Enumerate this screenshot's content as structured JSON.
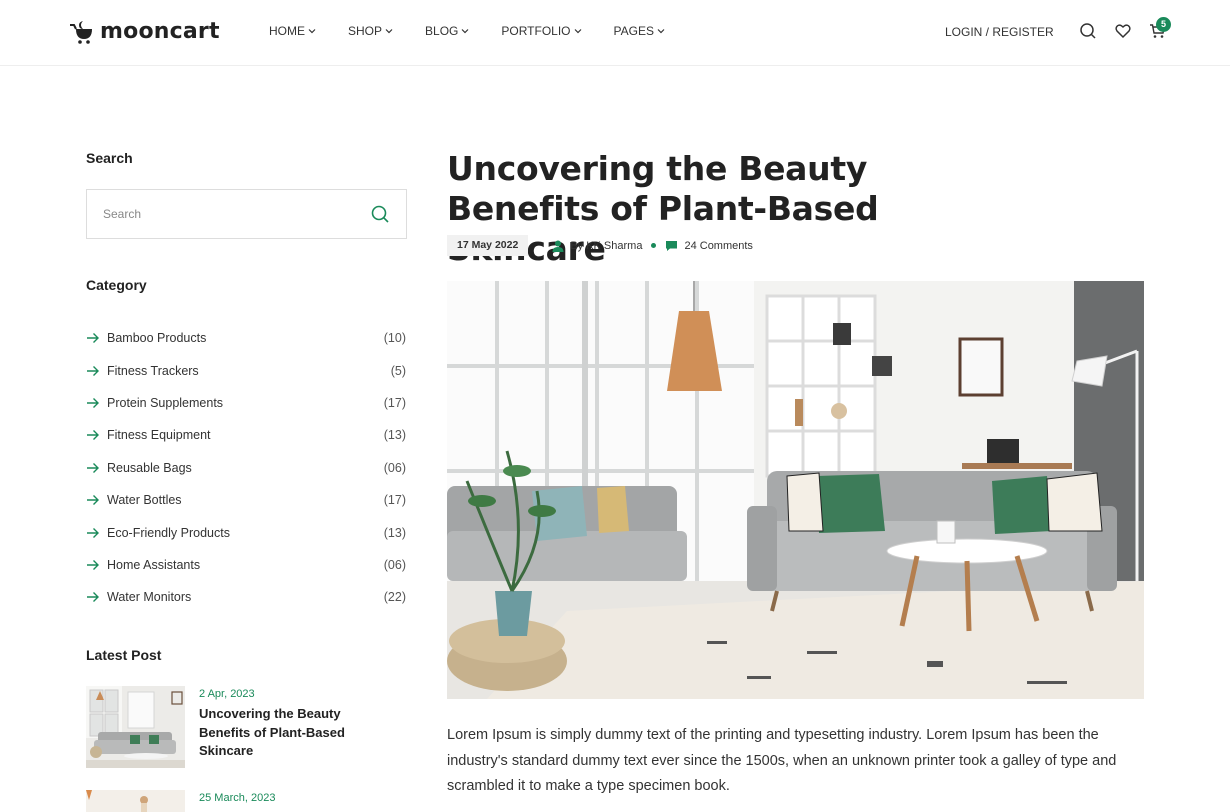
{
  "header": {
    "logo_text": "mooncart",
    "nav": [
      {
        "label": "HOME"
      },
      {
        "label": "SHOP"
      },
      {
        "label": "BLOG"
      },
      {
        "label": "PORTFOLIO"
      },
      {
        "label": "PAGES"
      }
    ],
    "login_label": "LOGIN / REGISTER",
    "cart_count": "5"
  },
  "sidebar": {
    "search_title": "Search",
    "search_placeholder": "Search",
    "category_title": "Category",
    "categories": [
      {
        "name": "Bamboo Products",
        "count": "(10)"
      },
      {
        "name": "Fitness Trackers",
        "count": "(5)"
      },
      {
        "name": "Protein Supplements",
        "count": "(17)"
      },
      {
        "name": "Fitness Equipment",
        "count": "(13)"
      },
      {
        "name": "Reusable Bags",
        "count": "(06)"
      },
      {
        "name": "Water Bottles",
        "count": "(17)"
      },
      {
        "name": "Eco-Friendly Products",
        "count": "(13)"
      },
      {
        "name": "Home Assistants",
        "count": "(06)"
      },
      {
        "name": "Water Monitors",
        "count": "(22)"
      }
    ],
    "latest_title": "Latest Post",
    "posts": [
      {
        "date": "2 Apr, 2023",
        "title": "Uncovering the Beauty Benefits of Plant-Based Skincare"
      },
      {
        "date": "25 March, 2023",
        "title": ""
      }
    ]
  },
  "article": {
    "title": "Uncovering the Beauty Benefits of Plant-Based Skincare",
    "date": "17 May 2022",
    "author": "By KK Sharma",
    "comments": "24 Comments",
    "body": "Lorem Ipsum is simply dummy text of the printing and typesetting industry. Lorem Ipsum has been the industry's standard dummy text ever since the 1500s, when an unknown printer took a galley of type and scrambled it to make a type specimen book."
  },
  "colors": {
    "accent": "#1a8a5a",
    "text": "#222222",
    "border": "#dddddd"
  },
  "icons": [
    "moon-cart-logo-icon",
    "chevron-down-icon",
    "search-icon",
    "heart-icon",
    "cart-icon",
    "arrow-right-icon",
    "user-icon",
    "comment-icon"
  ]
}
